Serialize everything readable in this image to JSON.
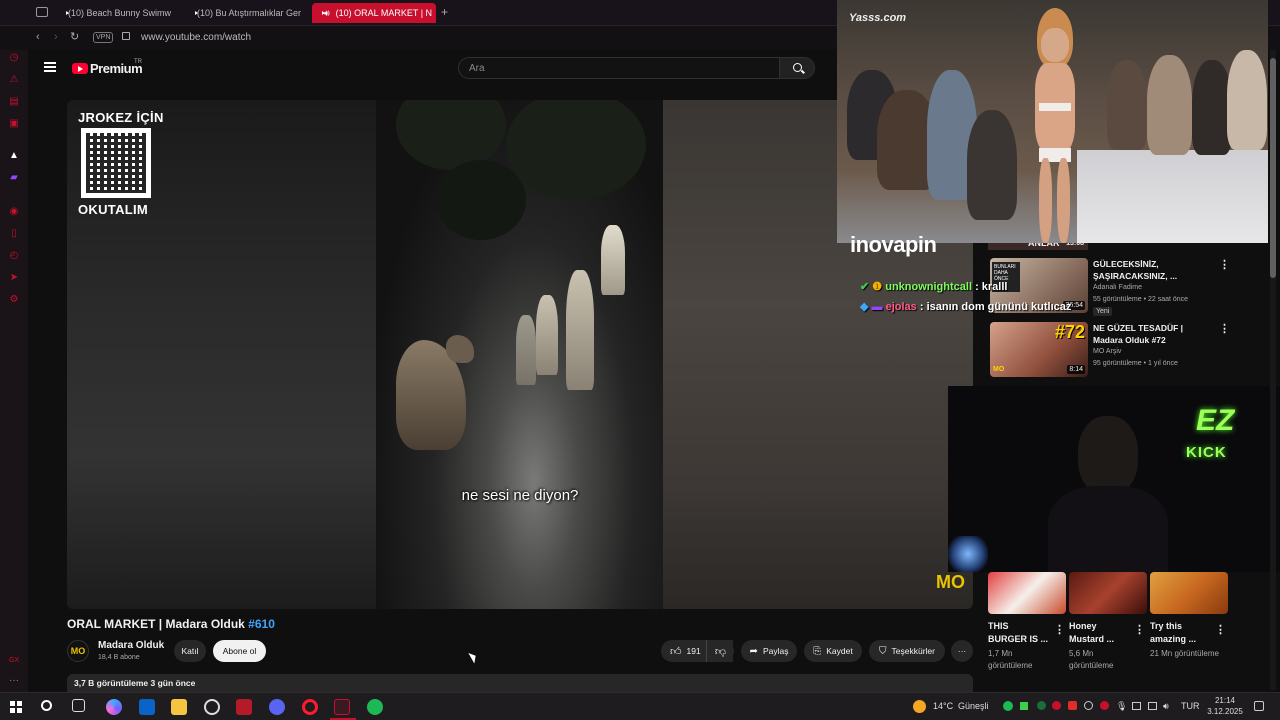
{
  "browser": {
    "tabs": [
      {
        "label": "(10) Beach Bunny Swimw"
      },
      {
        "label": "(10) Bu Atıştırmalıklar Ger"
      },
      {
        "label": "(10) ORAL MARKET | N"
      }
    ],
    "new_tab": "+",
    "vpn": "VPN",
    "url": "www.youtube.com/watch"
  },
  "youtube": {
    "logo": "Premium",
    "region": "TR",
    "search_placeholder": "Ara",
    "video": {
      "qr_title_top": "JROKEZ İÇİN",
      "qr_title_bottom": "OKUTALIM",
      "subtitle": "ne sesi ne diyon?",
      "badge": "MO"
    },
    "title": "ORAL MARKET | Madara Olduk",
    "title_tag": "#610",
    "channel": {
      "logo": "MO",
      "name": "Madara Olduk",
      "subs": "18,4 B abone"
    },
    "buttons": {
      "join": "Katıl",
      "subscribe": "Abone ol",
      "likes": "191",
      "share": "Paylaş",
      "save": "Kaydet",
      "thanks": "Teşekkürler",
      "more": "···"
    },
    "description": "3,7 B görüntüleme  3 gün önce",
    "recommended": [
      {
        "title": "GÜLECEKSİNİZ, ŞAŞIRACAKSINIZ, ...",
        "channel": "Adanalı Fadime",
        "meta": "55 görüntüleme • 22 saat önce",
        "badge": "Yeni",
        "duration": "26:54"
      },
      {
        "title": "NE GÜZEL TESADÜF | Madara Olduk #72",
        "channel": "MO Arşiv",
        "meta": "95 görüntüleme • 1 yıl önce",
        "duration": "8:14",
        "thumb_text": "#72"
      }
    ],
    "rec_header_fragment": {
      "text": "ANLAR",
      "duration": "13:08"
    },
    "shorts": [
      {
        "title": "THIS BURGER IS ...",
        "views": "1,7 Mn görüntüleme"
      },
      {
        "title": "Honey Mustard ...",
        "views": "5,6 Mn görüntüleme"
      },
      {
        "title": "Try this amazing ...",
        "views": "21 Mn görüntüleme"
      }
    ]
  },
  "overlay": {
    "watermark": "Yasss.com",
    "sponsor": "inovapin",
    "kick_top": "EZ",
    "kick_bottom": "KICK",
    "chat": [
      {
        "user": "unknownightcall",
        "message": ": kralll",
        "color": "#7cfc5a"
      },
      {
        "user": "ejolas",
        "message": ": isanın dom gününü kutlıcaz",
        "color": "#ff5a8a"
      }
    ]
  },
  "taskbar": {
    "weather_temp": "14°C",
    "weather_text": "Güneşli",
    "lang": "TUR",
    "time": "21:14",
    "date": "3.12.2025"
  },
  "colors": {
    "accent": "#c8102e",
    "youtube_red": "#ff0033",
    "link_blue": "#3ea6ff",
    "kick_green": "#9dff5a"
  }
}
